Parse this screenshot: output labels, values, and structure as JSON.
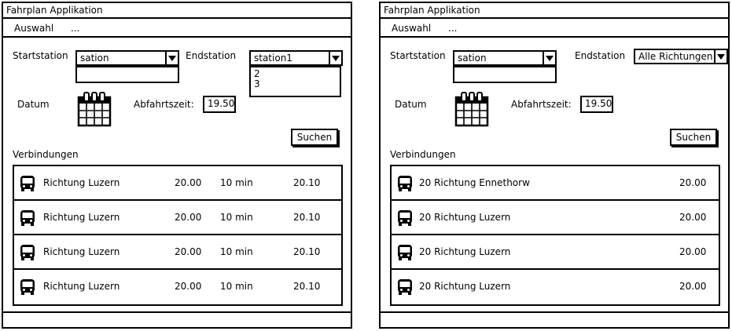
{
  "left": {
    "title": "Fahrplan Applikation",
    "menu": [
      "Auswahl",
      "..."
    ],
    "start_label": "Startstation",
    "start_value": "sation",
    "end_label": "Endstation",
    "end_value": "station1",
    "end_options": [
      "2",
      "3"
    ],
    "date_label": "Datum",
    "time_label": "Abfahrtszeit:",
    "time_value": "19.50",
    "search_button": "Suchen",
    "connections_label": "Verbindungen",
    "connections": [
      {
        "direction": "Richtung Luzern",
        "departure": "20.00",
        "duration": "10 min",
        "arrival": "20.10"
      },
      {
        "direction": "Richtung Luzern",
        "departure": "20.00",
        "duration": "10 min",
        "arrival": "20.10"
      },
      {
        "direction": "Richtung Luzern",
        "departure": "20.00",
        "duration": "10 min",
        "arrival": "20.10"
      },
      {
        "direction": "Richtung Luzern",
        "departure": "20.00",
        "duration": "10 min",
        "arrival": "20.10"
      }
    ]
  },
  "right": {
    "title": "Fahrplan Applikation",
    "menu": [
      "Auswahl",
      "..."
    ],
    "start_label": "Startstation",
    "start_value": "sation",
    "end_label": "Endstation",
    "end_value": "Alle Richtungen",
    "date_label": "Datum",
    "time_label": "Abfahrtszeit:",
    "time_value": "19.50",
    "search_button": "Suchen",
    "connections_label": "Verbindungen",
    "connections": [
      {
        "direction": "20 Richtung Ennethorw",
        "departure": "20.00"
      },
      {
        "direction": "20 Richtung Luzern",
        "departure": "20.00"
      },
      {
        "direction": "20 Richtung Luzern",
        "departure": "20.00"
      },
      {
        "direction": "20 Richtung Luzern",
        "departure": "20.00"
      }
    ],
    "icons": {
      "calendar": "calendar-icon",
      "bus": "bus-icon",
      "dropdown": "chevron-down-icon"
    }
  }
}
